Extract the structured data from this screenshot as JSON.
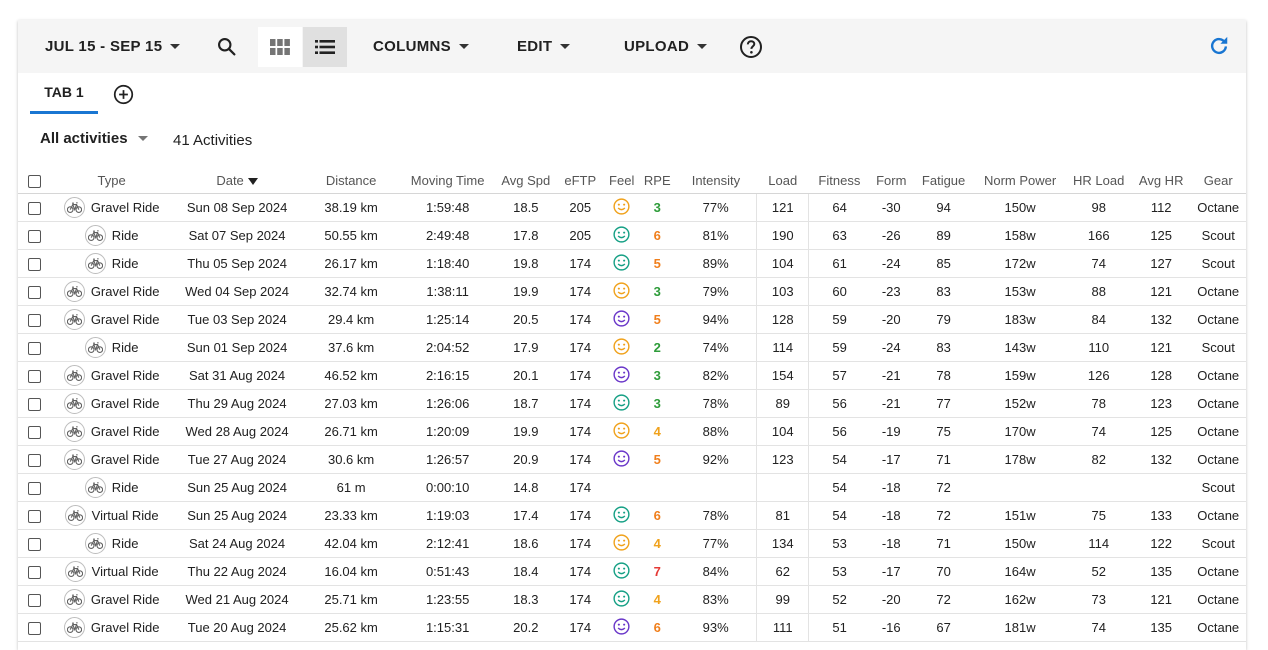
{
  "toolbar": {
    "date_range": "JUL 15 - SEP 15",
    "columns_label": "COLUMNS",
    "edit_label": "EDIT",
    "upload_label": "UPLOAD",
    "icons": [
      "search-icon",
      "grid-view-icon",
      "list-view-icon",
      "help-icon",
      "refresh-icon"
    ],
    "accent_color": "#1976d2"
  },
  "tabs": [
    {
      "label": "TAB 1",
      "active": true
    }
  ],
  "filter": {
    "selected": "All activities",
    "count_text": "41 Activities"
  },
  "table": {
    "headers": {
      "type": "Type",
      "date": "Date",
      "distance": "Distance",
      "moving_time": "Moving Time",
      "avg_spd": "Avg Spd",
      "eftp": "eFTP",
      "feel": "Feel",
      "rpe": "RPE",
      "intensity": "Intensity",
      "load": "Load",
      "fitness": "Fitness",
      "form": "Form",
      "fatigue": "Fatigue",
      "norm_power": "Norm Power",
      "hr_load": "HR Load",
      "avg_hr": "Avg HR",
      "gear": "Gear"
    },
    "sorted_by": "date",
    "feel_colors": {
      "orange": "#f0a21c",
      "teal": "#16a085",
      "purple": "#6a37c9"
    },
    "rpe_colors": {
      "2": "#2e9c3a",
      "3": "#2e9c3a",
      "4": "#f0a21c",
      "5": "#f07f1c",
      "6": "#f07f1c",
      "7": "#e53935"
    },
    "rows": [
      {
        "type": "Gravel Ride",
        "date": "Sun 08 Sep 2024",
        "distance": "38.19 km",
        "moving_time": "1:59:48",
        "avg_spd": "18.5",
        "eftp": "205",
        "feel": "orange",
        "rpe": "3",
        "intensity": "77%",
        "load": "121",
        "fitness": "64",
        "form": "-30",
        "fatigue": "94",
        "norm_power": "150w",
        "hr_load": "98",
        "avg_hr": "112",
        "gear": "Octane"
      },
      {
        "type": "Ride",
        "date": "Sat 07 Sep 2024",
        "distance": "50.55 km",
        "moving_time": "2:49:48",
        "avg_spd": "17.8",
        "eftp": "205",
        "feel": "teal",
        "rpe": "6",
        "intensity": "81%",
        "load": "190",
        "fitness": "63",
        "form": "-26",
        "fatigue": "89",
        "norm_power": "158w",
        "hr_load": "166",
        "avg_hr": "125",
        "gear": "Scout"
      },
      {
        "type": "Ride",
        "date": "Thu 05 Sep 2024",
        "distance": "26.17 km",
        "moving_time": "1:18:40",
        "avg_spd": "19.8",
        "eftp": "174",
        "feel": "teal",
        "rpe": "5",
        "intensity": "89%",
        "load": "104",
        "fitness": "61",
        "form": "-24",
        "fatigue": "85",
        "norm_power": "172w",
        "hr_load": "74",
        "avg_hr": "127",
        "gear": "Scout"
      },
      {
        "type": "Gravel Ride",
        "date": "Wed 04 Sep 2024",
        "distance": "32.74 km",
        "moving_time": "1:38:11",
        "avg_spd": "19.9",
        "eftp": "174",
        "feel": "orange",
        "rpe": "3",
        "intensity": "79%",
        "load": "103",
        "fitness": "60",
        "form": "-23",
        "fatigue": "83",
        "norm_power": "153w",
        "hr_load": "88",
        "avg_hr": "121",
        "gear": "Octane"
      },
      {
        "type": "Gravel Ride",
        "date": "Tue 03 Sep 2024",
        "distance": "29.4 km",
        "moving_time": "1:25:14",
        "avg_spd": "20.5",
        "eftp": "174",
        "feel": "purple",
        "rpe": "5",
        "intensity": "94%",
        "load": "128",
        "fitness": "59",
        "form": "-20",
        "fatigue": "79",
        "norm_power": "183w",
        "hr_load": "84",
        "avg_hr": "132",
        "gear": "Octane"
      },
      {
        "type": "Ride",
        "date": "Sun 01 Sep 2024",
        "distance": "37.6 km",
        "moving_time": "2:04:52",
        "avg_spd": "17.9",
        "eftp": "174",
        "feel": "orange",
        "rpe": "2",
        "intensity": "74%",
        "load": "114",
        "fitness": "59",
        "form": "-24",
        "fatigue": "83",
        "norm_power": "143w",
        "hr_load": "110",
        "avg_hr": "121",
        "gear": "Scout"
      },
      {
        "type": "Gravel Ride",
        "date": "Sat 31 Aug 2024",
        "distance": "46.52 km",
        "moving_time": "2:16:15",
        "avg_spd": "20.1",
        "eftp": "174",
        "feel": "purple",
        "rpe": "3",
        "intensity": "82%",
        "load": "154",
        "fitness": "57",
        "form": "-21",
        "fatigue": "78",
        "norm_power": "159w",
        "hr_load": "126",
        "avg_hr": "128",
        "gear": "Octane"
      },
      {
        "type": "Gravel Ride",
        "date": "Thu 29 Aug 2024",
        "distance": "27.03 km",
        "moving_time": "1:26:06",
        "avg_spd": "18.7",
        "eftp": "174",
        "feel": "teal",
        "rpe": "3",
        "intensity": "78%",
        "load": "89",
        "fitness": "56",
        "form": "-21",
        "fatigue": "77",
        "norm_power": "152w",
        "hr_load": "78",
        "avg_hr": "123",
        "gear": "Octane"
      },
      {
        "type": "Gravel Ride",
        "date": "Wed 28 Aug 2024",
        "distance": "26.71 km",
        "moving_time": "1:20:09",
        "avg_spd": "19.9",
        "eftp": "174",
        "feel": "orange",
        "rpe": "4",
        "intensity": "88%",
        "load": "104",
        "fitness": "56",
        "form": "-19",
        "fatigue": "75",
        "norm_power": "170w",
        "hr_load": "74",
        "avg_hr": "125",
        "gear": "Octane"
      },
      {
        "type": "Gravel Ride",
        "date": "Tue 27 Aug 2024",
        "distance": "30.6 km",
        "moving_time": "1:26:57",
        "avg_spd": "20.9",
        "eftp": "174",
        "feel": "purple",
        "rpe": "5",
        "intensity": "92%",
        "load": "123",
        "fitness": "54",
        "form": "-17",
        "fatigue": "71",
        "norm_power": "178w",
        "hr_load": "82",
        "avg_hr": "132",
        "gear": "Octane"
      },
      {
        "type": "Ride",
        "date": "Sun 25 Aug 2024",
        "distance": "61 m",
        "moving_time": "0:00:10",
        "avg_spd": "14.8",
        "eftp": "174",
        "feel": "",
        "rpe": "",
        "intensity": "",
        "load": "",
        "fitness": "54",
        "form": "-18",
        "fatigue": "72",
        "norm_power": "",
        "hr_load": "",
        "avg_hr": "",
        "gear": "Scout"
      },
      {
        "type": "Virtual Ride",
        "date": "Sun 25 Aug 2024",
        "distance": "23.33 km",
        "moving_time": "1:19:03",
        "avg_spd": "17.4",
        "eftp": "174",
        "feel": "teal",
        "rpe": "6",
        "intensity": "78%",
        "load": "81",
        "fitness": "54",
        "form": "-18",
        "fatigue": "72",
        "norm_power": "151w",
        "hr_load": "75",
        "avg_hr": "133",
        "gear": "Octane"
      },
      {
        "type": "Ride",
        "date": "Sat 24 Aug 2024",
        "distance": "42.04 km",
        "moving_time": "2:12:41",
        "avg_spd": "18.6",
        "eftp": "174",
        "feel": "orange",
        "rpe": "4",
        "intensity": "77%",
        "load": "134",
        "fitness": "53",
        "form": "-18",
        "fatigue": "71",
        "norm_power": "150w",
        "hr_load": "114",
        "avg_hr": "122",
        "gear": "Scout"
      },
      {
        "type": "Virtual Ride",
        "date": "Thu 22 Aug 2024",
        "distance": "16.04 km",
        "moving_time": "0:51:43",
        "avg_spd": "18.4",
        "eftp": "174",
        "feel": "teal",
        "rpe": "7",
        "intensity": "84%",
        "load": "62",
        "fitness": "53",
        "form": "-17",
        "fatigue": "70",
        "norm_power": "164w",
        "hr_load": "52",
        "avg_hr": "135",
        "gear": "Octane"
      },
      {
        "type": "Gravel Ride",
        "date": "Wed 21 Aug 2024",
        "distance": "25.71 km",
        "moving_time": "1:23:55",
        "avg_spd": "18.3",
        "eftp": "174",
        "feel": "teal",
        "rpe": "4",
        "intensity": "83%",
        "load": "99",
        "fitness": "52",
        "form": "-20",
        "fatigue": "72",
        "norm_power": "162w",
        "hr_load": "73",
        "avg_hr": "121",
        "gear": "Octane"
      },
      {
        "type": "Gravel Ride",
        "date": "Tue 20 Aug 2024",
        "distance": "25.62 km",
        "moving_time": "1:15:31",
        "avg_spd": "20.2",
        "eftp": "174",
        "feel": "purple",
        "rpe": "6",
        "intensity": "93%",
        "load": "111",
        "fitness": "51",
        "form": "-16",
        "fatigue": "67",
        "norm_power": "181w",
        "hr_load": "74",
        "avg_hr": "135",
        "gear": "Octane"
      }
    ]
  }
}
